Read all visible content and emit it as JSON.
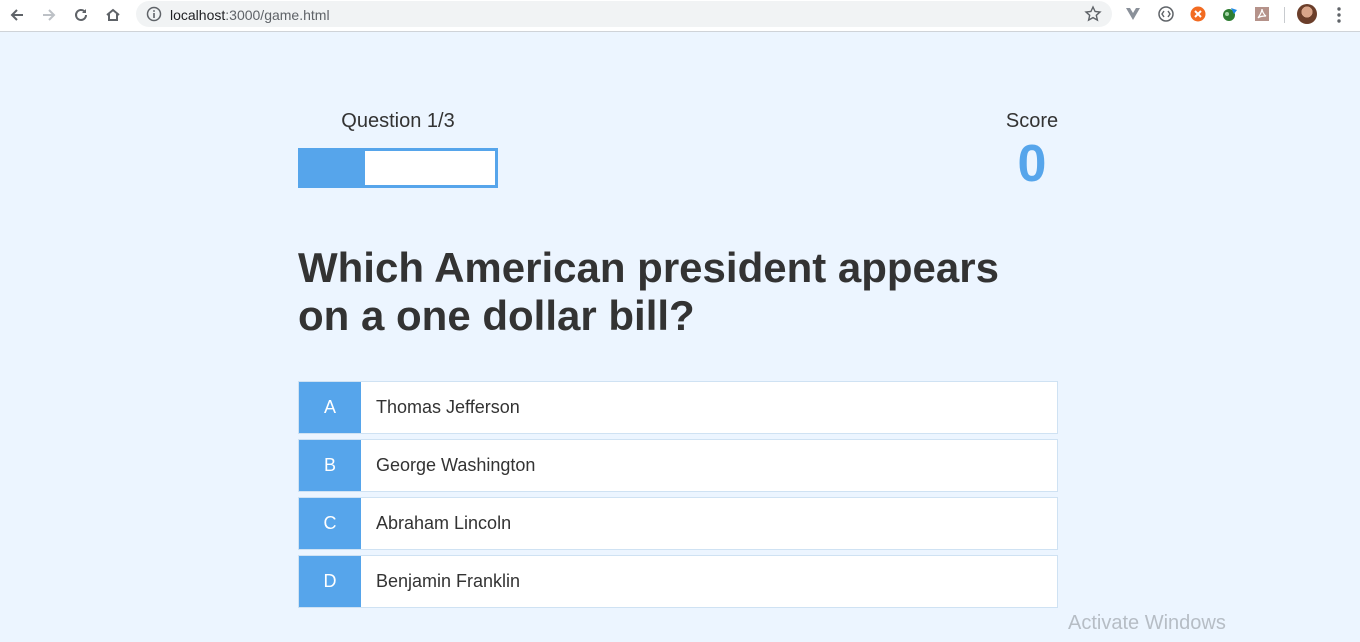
{
  "browser": {
    "url_host": "localhost",
    "url_rest": ":3000/game.html"
  },
  "hud": {
    "question_label": "Question 1/3",
    "progress_fraction": 0.33,
    "score_label": "Score",
    "score_value": "0"
  },
  "question": "Which American president appears on a one dollar bill?",
  "choices": [
    {
      "prefix": "A",
      "text": "Thomas Jefferson"
    },
    {
      "prefix": "B",
      "text": "George Washington"
    },
    {
      "prefix": "C",
      "text": "Abraham Lincoln"
    },
    {
      "prefix": "D",
      "text": "Benjamin Franklin"
    }
  ],
  "watermark": {
    "title": "Activate Windows"
  },
  "colors": {
    "accent": "#56a5eb",
    "background": "#ecf5ff",
    "text": "#333333"
  }
}
